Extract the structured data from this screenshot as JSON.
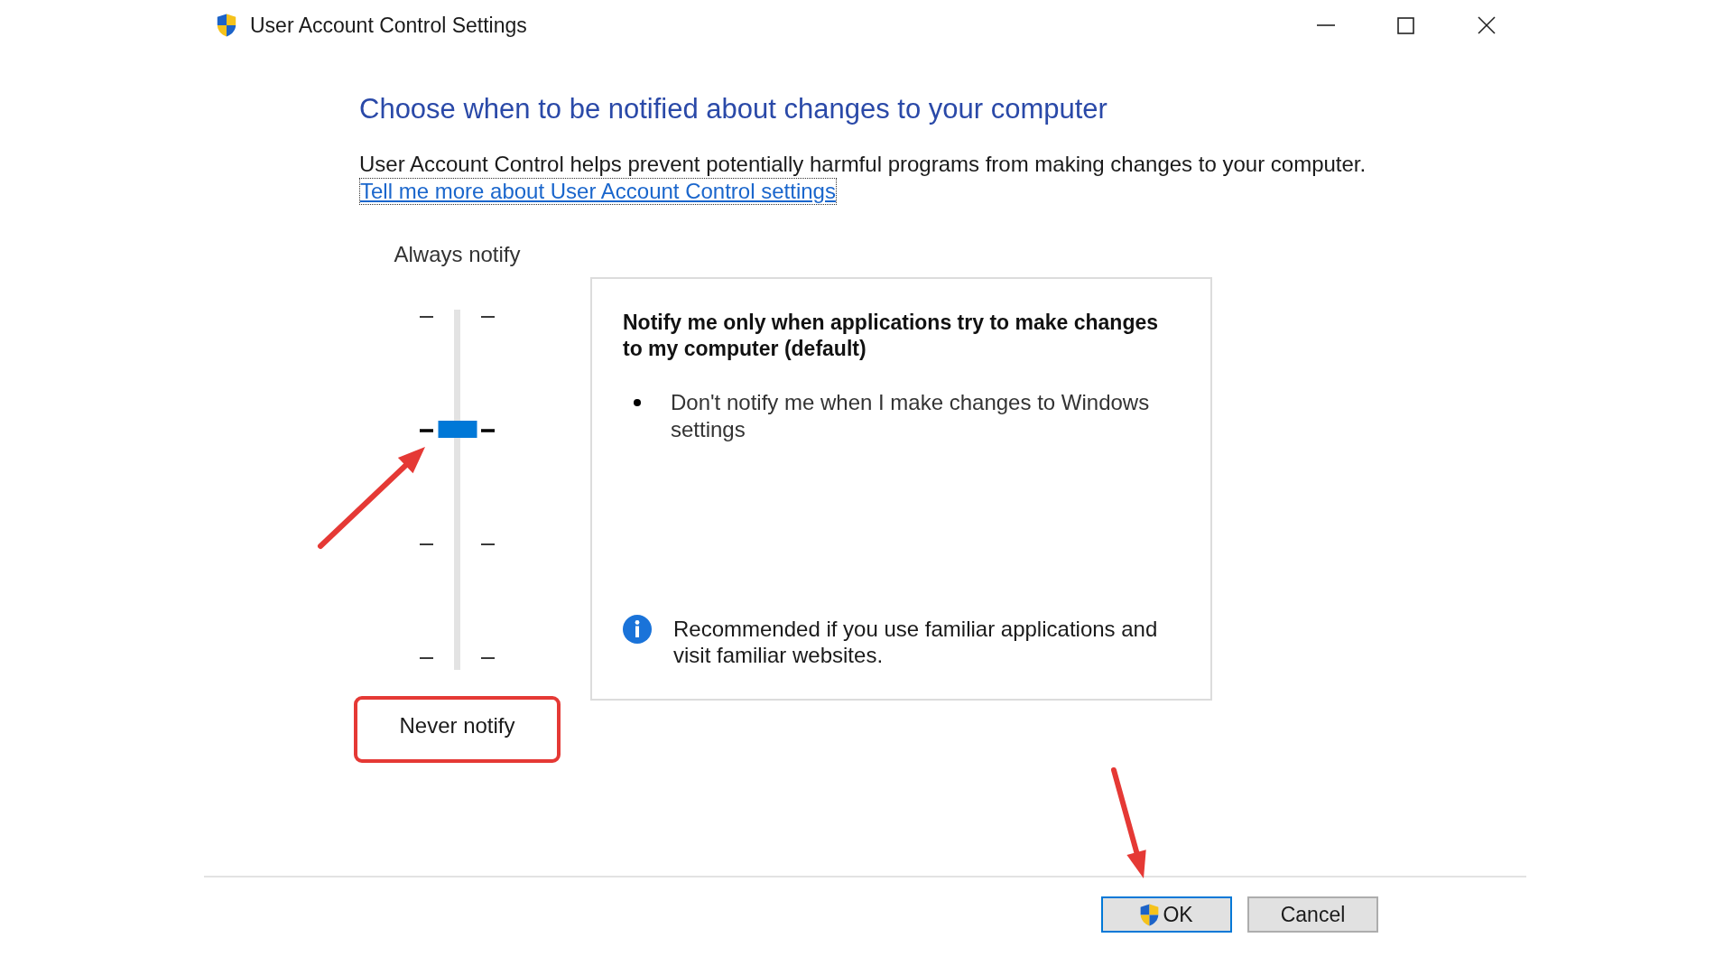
{
  "window": {
    "title": "User Account Control Settings"
  },
  "heading": "Choose when to be notified about changes to your computer",
  "description": "User Account Control helps prevent potentially harmful programs from making changes to your computer.",
  "help_link": {
    "text": "Tell me more about User Account Control settings",
    "focused": true
  },
  "slider": {
    "top_label": "Always notify",
    "bottom_label": "Never notify",
    "level": 0.67
  },
  "setting_details": {
    "title": "Notify me only when applications try to make changes to my computer (default)",
    "bullets": [
      "Don't notify me when I make changes to Windows settings"
    ],
    "recommendation": "Recommended if you use familiar applications and visit familiar websites."
  },
  "buttons": [
    {
      "label": "OK",
      "kind": "shield",
      "default": true
    },
    {
      "label": "Cancel",
      "kind": "plain",
      "default": false
    }
  ]
}
